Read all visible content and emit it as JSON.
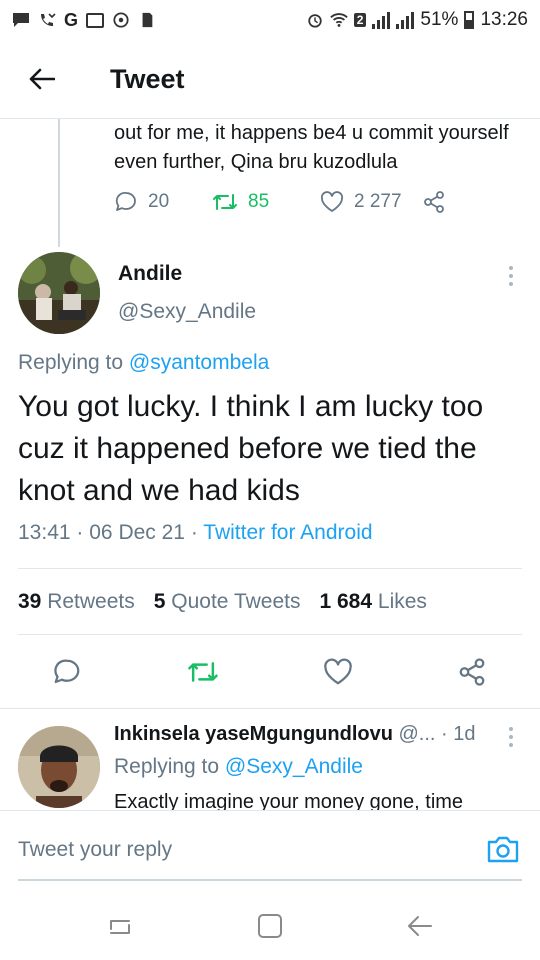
{
  "status_bar": {
    "left_icons": [
      "chat-icon",
      "missed-call-icon",
      "google-icon",
      "gallery-icon",
      "cast-icon",
      "sd-card-icon"
    ],
    "google_glyph": "G",
    "sim_badge": "2",
    "battery": "51%",
    "time": "13:26"
  },
  "header": {
    "title": "Tweet"
  },
  "previous_tweet": {
    "text": "out for me, it happens be4 u commit yourself even further, Qina bru kuzodlula",
    "replies": "20",
    "retweets": "85",
    "likes": "2 277"
  },
  "main_tweet": {
    "author_name": "Andile",
    "author_handle": "@Sexy_Andile",
    "replying_prefix": "Replying to",
    "replying_handle": "@syantombela",
    "text": "You got lucky. I think I am lucky too cuz it happened before we tied the knot and we had kids",
    "time": "13:41",
    "date": "06 Dec 21",
    "source": "Twitter for Android",
    "retweets_count": "39",
    "retweets_label": "Retweets",
    "quote_count": "5",
    "quote_label": "Quote Tweets",
    "likes_count": "1 684",
    "likes_label": "Likes"
  },
  "reply_tweet": {
    "author_name": "Inkinsela yaseMgungundlovu",
    "handle_truncated": "@...",
    "age": "1d",
    "replying_prefix": "Replying to",
    "replying_handle": "@Sexy_Andile",
    "text": "Exactly imagine your money gone, time"
  },
  "reply_bar": {
    "placeholder": "Tweet your reply"
  },
  "colors": {
    "link": "#1da1f2",
    "retweet": "#17bf63",
    "secondary_text": "#657786",
    "divider": "#e1e8ed"
  }
}
